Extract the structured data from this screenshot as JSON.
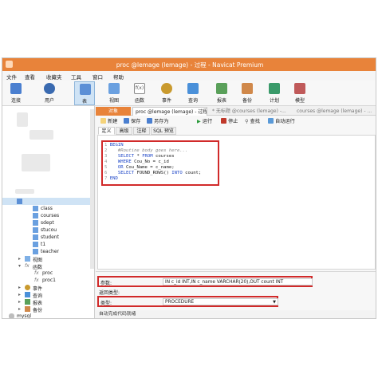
{
  "window": {
    "title": "proc @lemage (lemage) - 过程 - Navicat Premium"
  },
  "menu": [
    "文件",
    "查看",
    "收藏夹",
    "工具",
    "窗口",
    "帮助"
  ],
  "toolbar": [
    {
      "label": "连接",
      "icon": "connection-icon",
      "color": "#4a7fd0"
    },
    {
      "label": "用户",
      "icon": "user-icon",
      "color": "#3a6ab0"
    },
    {
      "label": "表",
      "icon": "table-icon",
      "color": "#5b8fd6"
    },
    {
      "label": "视图",
      "icon": "view-icon",
      "color": "#6aa0e0"
    },
    {
      "label": "函数",
      "icon": "function-icon",
      "color": "#8a8a8a"
    },
    {
      "label": "事件",
      "icon": "event-icon",
      "color": "#c99a2e"
    },
    {
      "label": "查询",
      "icon": "query-icon",
      "color": "#4a90d9"
    },
    {
      "label": "报表",
      "icon": "report-icon",
      "color": "#5aa05a"
    },
    {
      "label": "备份",
      "icon": "backup-icon",
      "color": "#d0884a"
    },
    {
      "label": "计划",
      "icon": "schedule-icon",
      "color": "#3a9a6a"
    },
    {
      "label": "模型",
      "icon": "model-icon",
      "color": "#c05a5a"
    }
  ],
  "tree": {
    "tables": [
      "class",
      "courses",
      "sdept",
      "stucou",
      "student",
      "t1",
      "teacher"
    ],
    "views_label": "视图",
    "functions_label": "函数",
    "functions": [
      "proc",
      "proc1"
    ],
    "events_label": "事件",
    "queries_label": "查询",
    "reports_label": "报表",
    "backups_label": "备份",
    "other_dbs": [
      "mysql"
    ]
  },
  "tabs": {
    "object": "对象",
    "proc": "proc @lemage (lemage) - 过程",
    "untitled": "* 无标题 @courses (lemage) -...",
    "courses": "courses @lemage (lemage) - ..."
  },
  "editor_toolbar": {
    "new": "新建",
    "save": "保存",
    "save_as": "另存为",
    "run": "运行",
    "stop": "停止",
    "find": "查找",
    "auto_run": "自动运行"
  },
  "subtabs": [
    "定义",
    "高级",
    "注释",
    "SQL 预览"
  ],
  "code": {
    "begin": "BEGIN",
    "comment": "#Routine body goes here...",
    "line1": [
      "SELECT",
      " * ",
      "FROM",
      " courses"
    ],
    "line2": [
      "WHERE",
      " Cou_No = c_id"
    ],
    "line3": [
      "OR",
      " Cou_Name = c_name;"
    ],
    "line4": [
      "SELECT",
      " FOUND_ROWS() ",
      "INTO",
      " count;"
    ],
    "end": "END"
  },
  "form": {
    "params_label": "参数:",
    "params_value": "IN c_id INT,IN c_name VARCHAR(20),OUT count INT",
    "return_label": "返回类型:",
    "type_label": "类型:",
    "type_value": "PROCEDURE"
  },
  "status": "自动完成代码就绪",
  "colors": {
    "titlebar": "#e8833a",
    "highlight": "#d12a2a",
    "keyword": "#2048c8"
  }
}
